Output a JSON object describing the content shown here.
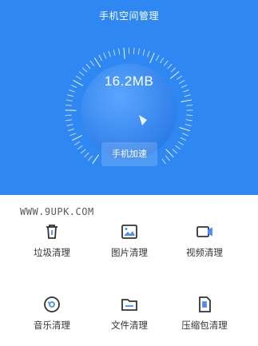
{
  "header": {
    "title": "手机空间管理",
    "storage_value": "16.2MB",
    "speed_button": "手机加速"
  },
  "watermark": "WWW.9UPK.COM",
  "tools": [
    {
      "label": "垃圾清理",
      "icon": "trash-icon"
    },
    {
      "label": "图片清理",
      "icon": "image-icon"
    },
    {
      "label": "视频清理",
      "icon": "video-icon"
    },
    {
      "label": "音乐清理",
      "icon": "music-disc-icon"
    },
    {
      "label": "文件清理",
      "icon": "folder-icon"
    },
    {
      "label": "压缩包清理",
      "icon": "archive-icon"
    }
  ],
  "colors": {
    "primary": "#2f88f2",
    "icon_stroke": "#333333",
    "icon_accent": "#4a8ff2"
  }
}
